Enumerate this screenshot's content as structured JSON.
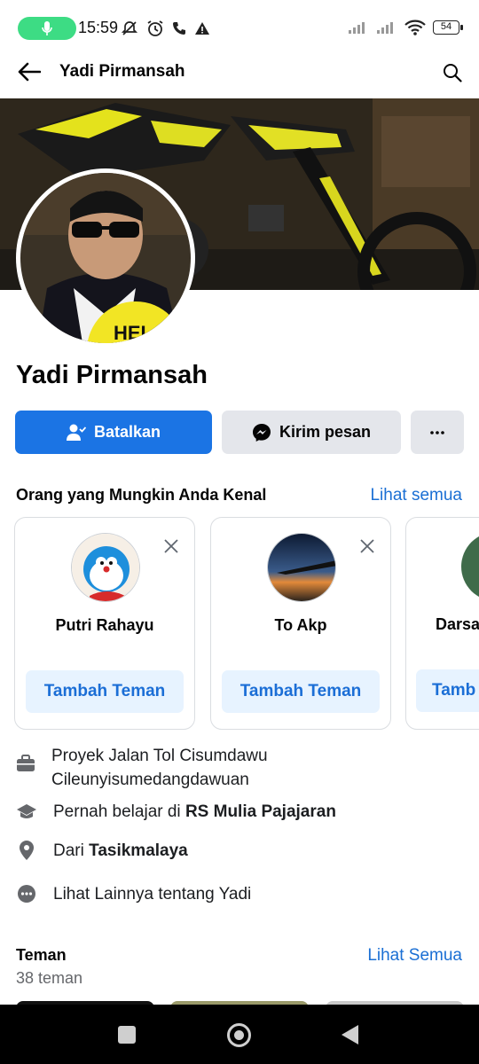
{
  "status_bar": {
    "time": "15:59",
    "battery": "54",
    "icons": [
      "mic-icon",
      "mute-icon",
      "alarm-icon",
      "call-icon",
      "warning-icon",
      "signal-icon",
      "signal-icon",
      "wifi-icon",
      "battery-icon"
    ]
  },
  "header": {
    "title": "Yadi Pirmansah"
  },
  "profile": {
    "name": "Yadi Pirmansah",
    "actions": {
      "cancel_label": "Batalkan",
      "message_label": "Kirim pesan"
    }
  },
  "pymk": {
    "title": "Orang yang Mungkin Anda Kenal",
    "see_all": "Lihat semua",
    "add_label": "Tambah Teman",
    "people": [
      {
        "name": "Putri Rahayu"
      },
      {
        "name": "To Akp"
      },
      {
        "name": "Darsa"
      }
    ],
    "third_add_label": "Tamb"
  },
  "intro": {
    "work": "Proyek Jalan Tol Cisumdawu Cileunyisumedangdawuan",
    "study_prefix": "Pernah belajar di ",
    "study_place": "RS Mulia Pajajaran",
    "from_prefix": "Dari ",
    "from_place": "Tasikmalaya",
    "more": "Lihat Lainnya tentang Yadi"
  },
  "friends": {
    "title": "Teman",
    "see_all": "Lihat Semua",
    "count": "38 teman"
  },
  "colors": {
    "primary": "#1b74e4",
    "link": "#1a6fd4",
    "secondary_bg": "#e4e6eb",
    "add_bg": "#e7f3ff"
  }
}
